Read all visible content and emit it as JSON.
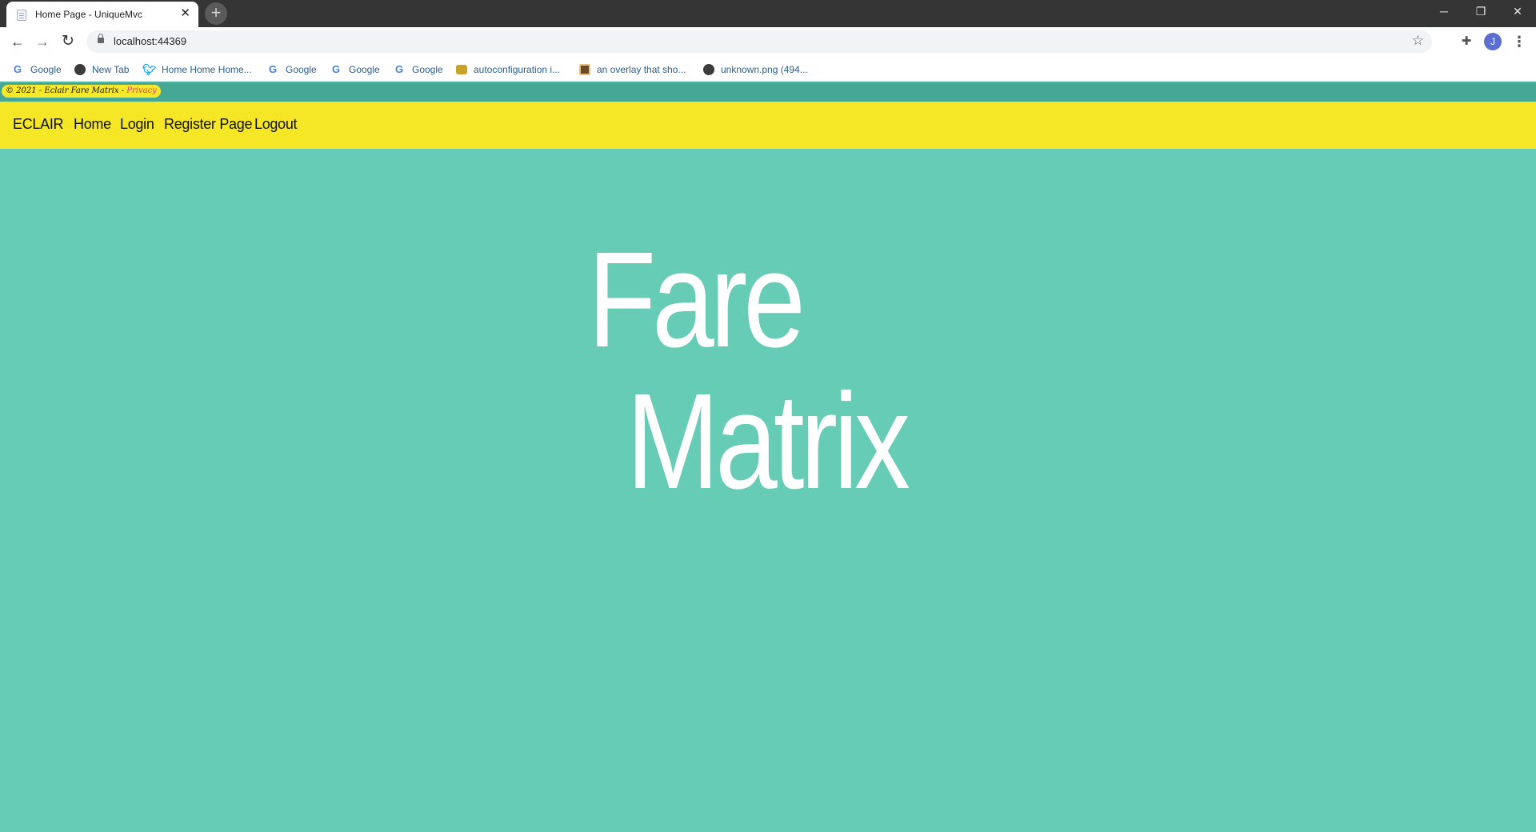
{
  "browser": {
    "tab_title": "Home Page - UniqueMvc",
    "tab_close_glyph": "✕",
    "new_tab_glyph": "+",
    "url": "localhost:44369",
    "profile_initial": "J",
    "window_controls": {
      "minimize": "─",
      "maximize": "❐",
      "close": "✕"
    },
    "bookmarks": [
      {
        "label": "Google",
        "icon": "google-icon"
      },
      {
        "label": "New Tab",
        "icon": "globe-icon"
      },
      {
        "label": "Home Home Home...",
        "icon": "twitter-icon"
      },
      {
        "label": "Google",
        "icon": "google-icon"
      },
      {
        "label": "Google",
        "icon": "google-icon"
      },
      {
        "label": "Google",
        "icon": "google-icon"
      },
      {
        "label": "autoconfiguration i...",
        "icon": "puzzle-icon"
      },
      {
        "label": "an overlay that sho...",
        "icon": "map-icon"
      },
      {
        "label": "unknown.png (494...",
        "icon": "globe-icon"
      }
    ]
  },
  "footer": {
    "text": "© 2021 - Eclair Fare Matrix - ",
    "privacy": "Privacy"
  },
  "navbar": {
    "brand": "ECLAIR",
    "links": [
      "Home",
      "Login",
      "Register Page",
      "Logout"
    ]
  },
  "hero": {
    "line1": "Fare",
    "line2": "Matrix"
  },
  "colors": {
    "page_bg": "#67ccb5",
    "footer_bar": "#44a895",
    "navbar_bg": "#f5e726",
    "privacy_link": "#e2386e",
    "hero_text": "#ffffff"
  }
}
